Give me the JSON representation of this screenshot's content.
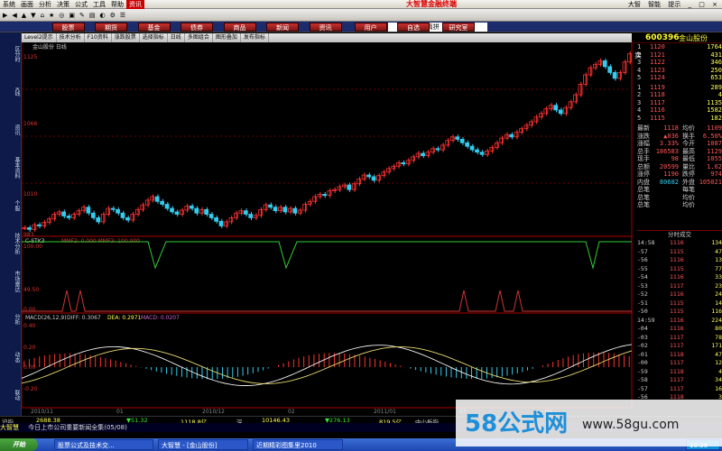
{
  "menubar": {
    "items": [
      "系统",
      "画面",
      "分析",
      "决策",
      "公式",
      "工具",
      "帮助",
      "资讯"
    ],
    "title": "大智慧金融终端",
    "right": [
      "大智",
      "智能",
      "提示"
    ]
  },
  "toolbar": {
    "items": [
      "▶",
      "◀",
      "▲",
      "▼",
      "⌂",
      "★",
      "◎",
      "▣",
      "✎",
      "▤",
      "◐",
      "⚙",
      "☰"
    ]
  },
  "nav": {
    "items": [
      "股票",
      "期货",
      "基金",
      "债券",
      "商品",
      "新闻",
      "资讯",
      "用户",
      "自选",
      "研究室"
    ],
    "search_placeholder": "代码/名称/简拼"
  },
  "subtoolbar": {
    "items": [
      "Level2提示",
      "技术分析",
      "F10资料",
      "涨跌股票",
      "选择指标",
      "日线",
      "多图组合",
      "图形叠加",
      "发布指标"
    ]
  },
  "leftbar": {
    "items": [
      "区分时",
      "K线",
      "资讯",
      "基本资料",
      "个股",
      "技术分析",
      "市场雷达",
      "分析",
      "动态",
      "联动"
    ]
  },
  "stock": {
    "code": "600396",
    "name": "金山股份",
    "subtitle": "金山股份 日线"
  },
  "price_axis": {
    "labels": [
      "1125",
      "1066",
      "1010",
      "983"
    ]
  },
  "indicator1": {
    "name": "C-STK3",
    "params": "MMF2: 0.000 MMF3: 100.000",
    "axis": [
      "100.00",
      "49.50",
      "0.00"
    ]
  },
  "macd": {
    "name": "MACD(26,12,9)",
    "diff": "DIFF: 0.3067",
    "dea": "DEA: 0.2971",
    "macd": "MACD: 0.0207",
    "axis": [
      "0.40",
      "0.20",
      "0.00",
      "-0.20"
    ]
  },
  "quote": {
    "asks": [
      {
        "n": "5",
        "p": "1124",
        "v": "653"
      },
      {
        "n": "4",
        "p": "1123",
        "v": "250"
      },
      {
        "n": "3",
        "p": "1122",
        "v": "346"
      },
      {
        "n": "2",
        "p": "1121",
        "v": "431"
      },
      {
        "n": "1",
        "p": "1120",
        "v": "1764"
      }
    ],
    "bids": [
      {
        "n": "1",
        "p": "1119",
        "v": "289"
      },
      {
        "n": "2",
        "p": "1118",
        "v": "4"
      },
      {
        "n": "3",
        "p": "1117",
        "v": "1135"
      },
      {
        "n": "4",
        "p": "1116",
        "v": "1582"
      },
      {
        "n": "5",
        "p": "1115",
        "v": "182"
      }
    ],
    "ask_label": "卖",
    "bid_label": "买",
    "stats": [
      [
        "最新",
        "1118",
        "均价",
        "1109"
      ],
      [
        "涨跌",
        "▲036",
        "换手",
        "6.50%"
      ],
      [
        "涨幅",
        "3.33%",
        "今开",
        "1087"
      ],
      [
        "总手",
        "186583",
        "最高",
        "1129"
      ],
      [
        "现手",
        "98",
        "最低",
        "1055"
      ],
      [
        "总额",
        "20599",
        "量比",
        "1.62"
      ],
      [
        "涨停",
        "1190",
        "跌停",
        "974"
      ],
      [
        "内盘",
        "80682",
        "外盘",
        "105021"
      ],
      [
        "总笔",
        "",
        "每笔",
        ""
      ],
      [
        "总笔",
        "",
        "均价",
        ""
      ],
      [
        "总笔",
        "",
        "均价",
        ""
      ]
    ],
    "tick_header": "分时成交"
  },
  "ticks": [
    [
      "14:58",
      "1116",
      "134"
    ],
    [
      "-57",
      "1115",
      "47"
    ],
    [
      "-56",
      "1116",
      "13"
    ],
    [
      "-55",
      "1115",
      "77"
    ],
    [
      "-54",
      "1116",
      "33"
    ],
    [
      "-53",
      "1117",
      "23"
    ],
    [
      "-52",
      "1116",
      "24"
    ],
    [
      "-51",
      "1115",
      "14"
    ],
    [
      "-50",
      "1115",
      "116"
    ],
    [
      "14:59",
      "1116",
      "224"
    ],
    [
      "-04",
      "1116",
      "80"
    ],
    [
      "-03",
      "1117",
      "78"
    ],
    [
      "-02",
      "1117",
      "171"
    ],
    [
      "-01",
      "1118",
      "47"
    ],
    [
      "-00",
      "1117",
      "12"
    ],
    [
      "-59",
      "1118",
      "4"
    ],
    [
      "-58",
      "1117",
      "34"
    ],
    [
      "-57",
      "1117",
      "16"
    ],
    [
      "-56",
      "1118",
      "3"
    ]
  ],
  "dates": [
    "2010/11",
    "01",
    "2010/12",
    "02",
    "2011/01",
    "03",
    "04"
  ],
  "bottom": [
    "沪指",
    "2688.38",
    "▼51.32",
    "1118.8亿",
    "深",
    "10146.43",
    "▼276.13",
    "819.5亿",
    "中小板指"
  ],
  "status": {
    "text": "今日上市公司重要新闻全集(05/08)",
    "label": "大智慧"
  },
  "taskbar": {
    "start": "开始",
    "items": [
      "股票公式及技术交...",
      "大智慧 - [金山股份]",
      "近期精彩图集里2010"
    ],
    "time": "10:38"
  },
  "watermark": {
    "text": "58公式网",
    "url": "www.58gu.com"
  },
  "colors": {
    "up": "#ff3333",
    "down": "#33ccee",
    "ma": "#f0e68c",
    "grid": "#6a0000"
  }
}
